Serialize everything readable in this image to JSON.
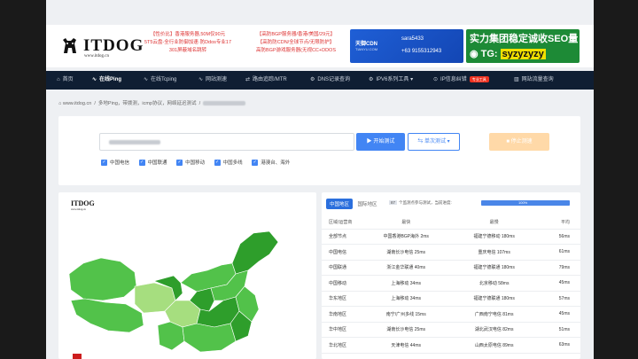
{
  "header": {
    "logo_text": "ITDOG",
    "logo_url": "www.itdog.cn",
    "ad_left": [
      "【性价比】香港服务器,50M仅90元",
      "5T5云盘-全行业防御加速·防Ddos专业17",
      "301屏蔽域名跳转"
    ],
    "ad_mid": [
      "【高防BGP服务器/香港/美国/29元】",
      "【高防防CDN/全球节点/无限防护】",
      "高防BGP游戏服务器(无视CC+DDOS"
    ],
    "banner1": {
      "brand": "天御CDN",
      "sub": "TIANYU.COM",
      "lines": [
        "sara5433",
        "+63 9155312943"
      ]
    },
    "banner2": {
      "title": "实力集团稳定诚收SEO量",
      "tg_label": "TG:",
      "tg_handle": "syzyzyzy"
    }
  },
  "nav": {
    "items": [
      {
        "label": "首页",
        "icon": "home-icon",
        "active": false
      },
      {
        "label": "在线Ping",
        "icon": "pulse-icon",
        "active": true
      },
      {
        "label": "在线Tcping",
        "icon": "pulse-icon",
        "active": false
      },
      {
        "label": "网站测速",
        "icon": "pulse-icon",
        "active": false
      },
      {
        "label": "路由追踪/MTR",
        "icon": "route-icon",
        "active": false
      },
      {
        "label": "DNS记录查询",
        "icon": "dns-icon",
        "active": false
      },
      {
        "label": "IPV6系列工具 ▾",
        "icon": "ipv6-icon",
        "active": false
      },
      {
        "label": "IP信息纠错",
        "icon": "location-icon",
        "active": false,
        "badge": "专业工具"
      },
      {
        "label": "网站流量查询",
        "icon": "chart-icon",
        "active": false
      }
    ]
  },
  "breadcrumb": {
    "home": "www.itdog.cn",
    "section": "多地Ping，带拨测，icmp协议，网络延迟测试"
  },
  "search": {
    "start_label": "开始测试",
    "single_label": "单次测试 ▾",
    "stop_label": "停止测速",
    "options": [
      {
        "label": "中国电信",
        "checked": true
      },
      {
        "label": "中国联通",
        "checked": true
      },
      {
        "label": "中国移动",
        "checked": true
      },
      {
        "label": "中国多线",
        "checked": true
      },
      {
        "label": "港澳台、海外",
        "checked": true
      }
    ]
  },
  "map": {
    "logo_text": "ITDOG",
    "logo_sub": "www.itdog.cn"
  },
  "results": {
    "tabs": [
      {
        "label": "中国地区",
        "active": true
      },
      {
        "label": "国际地区",
        "active": false
      }
    ],
    "progress_count": "87",
    "progress_text": "个监测点参与测试，当前进度:",
    "progress_label": "100%",
    "progress_value": 1.0,
    "columns": [
      "区域/运营商",
      "最快",
      "最慢",
      "平均"
    ],
    "rows": [
      {
        "region": "全部节点",
        "fastest": "中国香港BGP海外 2ms",
        "slowest": "福建宁德移动 180ms",
        "avg": "56ms"
      },
      {
        "region": "中国电信",
        "fastest": "湖南长沙电信 25ms",
        "slowest": "重庆电信 107ms",
        "avg": "61ms"
      },
      {
        "region": "中国联通",
        "fastest": "浙江金华联通 40ms",
        "slowest": "福建宁德联通 180ms",
        "avg": "79ms"
      },
      {
        "region": "中国移动",
        "fastest": "上海移动 34ms",
        "slowest": "北京移动 58ms",
        "avg": "45ms"
      },
      {
        "region": "华东地区",
        "fastest": "上海移动 34ms",
        "slowest": "福建宁德联通 180ms",
        "avg": "57ms"
      },
      {
        "region": "华南地区",
        "fastest": "南宁/广州多线 15ms",
        "slowest": "广西南宁电信 81ms",
        "avg": "45ms"
      },
      {
        "region": "华中地区",
        "fastest": "湖南长沙电信 25ms",
        "slowest": "湖北武汉电信 82ms",
        "avg": "51ms"
      },
      {
        "region": "华北地区",
        "fastest": "天津电信 44ms",
        "slowest": "山西太原电信 89ms",
        "avg": "63ms"
      }
    ]
  },
  "colors": {
    "nav_bg": "#0f1e33",
    "accent": "#4285f4",
    "map_dark": "#2e9e2b",
    "map_mid": "#52c24a",
    "map_light": "#a6de7f",
    "stop_btn": "#ffd9a8"
  }
}
